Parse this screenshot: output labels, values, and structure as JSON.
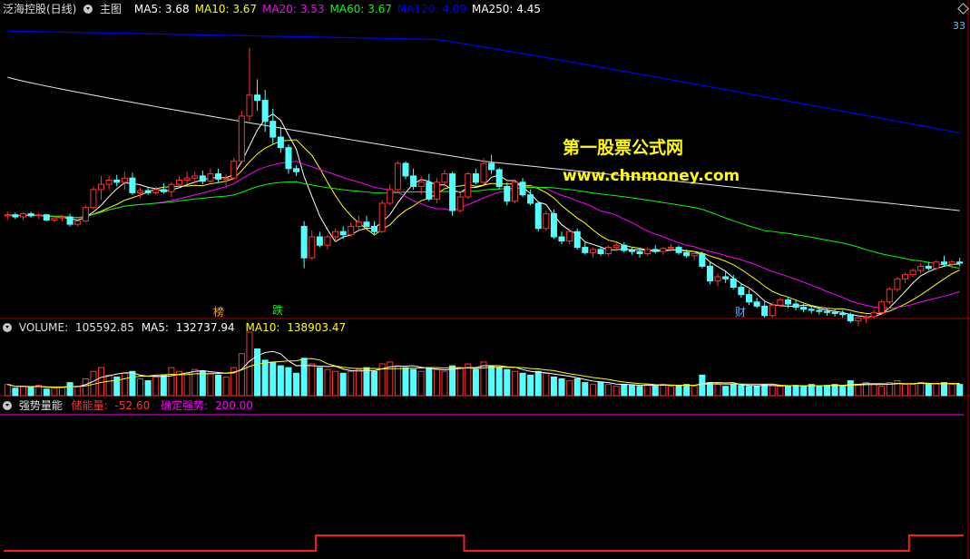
{
  "main": {
    "stock_name": "泛海控股(日线)",
    "panel_label": "主图",
    "ma": [
      {
        "label": "MA5:",
        "value": "3.68",
        "color": "#ffffff"
      },
      {
        "label": "MA10:",
        "value": "3.67",
        "color": "#ffff00"
      },
      {
        "label": "MA20:",
        "value": "3.53",
        "color": "#ff00ff"
      },
      {
        "label": "MA60:",
        "value": "3.67",
        "color": "#00ff00"
      },
      {
        "label": "MA120:",
        "value": "4.09",
        "color": "#0000ff"
      },
      {
        "label": "MA250:",
        "value": "4.45",
        "color": "#ffffff"
      }
    ],
    "corner_value": "33",
    "watermark_line1": "第一股票公式网",
    "watermark_line2": "www.chnmoney.com",
    "markers": [
      {
        "text": "榜",
        "color": "#ffaa00"
      },
      {
        "text": "跌",
        "color": "#00ff00"
      },
      {
        "text": "财",
        "color": "#66aaff"
      }
    ]
  },
  "volume": {
    "label": "VOLUME:",
    "value": "105592.85",
    "ma5_label": "MA5:",
    "ma5_value": "132737.94",
    "ma10_label": "MA10:",
    "ma10_value": "138903.47"
  },
  "indicator": {
    "name": "强势量能",
    "line1_label": "储能量:",
    "line1_value": "-52.60",
    "line2_label": "确定强势:",
    "line2_value": "200.00"
  },
  "colors": {
    "up": "#ff3232",
    "down": "#54ffff",
    "border": "#b00000",
    "ma5": "#ffffff",
    "ma10": "#ffff00",
    "ma20": "#ff00ff",
    "ma60": "#00ff00",
    "ma120": "#0000ff",
    "ma250": "#ffffff"
  },
  "chart_data": {
    "type": "candlestick",
    "ylim": [
      2.4,
      5.2
    ],
    "candles": [
      [
        3.3,
        3.34,
        3.26,
        3.31
      ],
      [
        3.31,
        3.33,
        3.27,
        3.29
      ],
      [
        3.29,
        3.33,
        3.26,
        3.32
      ],
      [
        3.32,
        3.34,
        3.28,
        3.3
      ],
      [
        3.3,
        3.33,
        3.27,
        3.31
      ],
      [
        3.31,
        3.32,
        3.25,
        3.26
      ],
      [
        3.26,
        3.3,
        3.24,
        3.28
      ],
      [
        3.28,
        3.31,
        3.25,
        3.29
      ],
      [
        3.29,
        3.32,
        3.2,
        3.22
      ],
      [
        3.22,
        3.26,
        3.2,
        3.25
      ],
      [
        3.25,
        3.4,
        3.24,
        3.38
      ],
      [
        3.38,
        3.58,
        3.36,
        3.55
      ],
      [
        3.55,
        3.68,
        3.45,
        3.6
      ],
      [
        3.6,
        3.68,
        3.55,
        3.64
      ],
      [
        3.64,
        3.69,
        3.58,
        3.62
      ],
      [
        3.62,
        3.72,
        3.55,
        3.66
      ],
      [
        3.66,
        3.71,
        3.5,
        3.52
      ],
      [
        3.52,
        3.57,
        3.47,
        3.54
      ],
      [
        3.54,
        3.57,
        3.5,
        3.52
      ],
      [
        3.52,
        3.58,
        3.5,
        3.55
      ],
      [
        3.55,
        3.61,
        3.51,
        3.53
      ],
      [
        3.53,
        3.62,
        3.48,
        3.6
      ],
      [
        3.6,
        3.68,
        3.57,
        3.64
      ],
      [
        3.64,
        3.72,
        3.6,
        3.66
      ],
      [
        3.66,
        3.72,
        3.62,
        3.68
      ],
      [
        3.68,
        3.73,
        3.6,
        3.63
      ],
      [
        3.63,
        3.75,
        3.61,
        3.7
      ],
      [
        3.7,
        3.75,
        3.62,
        3.65
      ],
      [
        3.65,
        3.7,
        3.58,
        3.66
      ],
      [
        3.66,
        3.85,
        3.65,
        3.82
      ],
      [
        3.82,
        4.3,
        3.8,
        4.25
      ],
      [
        4.25,
        4.9,
        4.2,
        4.45
      ],
      [
        4.45,
        4.6,
        4.3,
        4.4
      ],
      [
        4.4,
        4.5,
        4.1,
        4.2
      ],
      [
        4.2,
        4.32,
        3.98,
        4.05
      ],
      [
        4.05,
        4.15,
        3.9,
        3.95
      ],
      [
        3.95,
        3.98,
        3.7,
        3.75
      ],
      [
        3.75,
        3.78,
        3.68,
        3.72
      ],
      [
        3.2,
        3.25,
        2.8,
        2.9
      ],
      [
        2.9,
        3.16,
        2.88,
        3.1
      ],
      [
        3.1,
        3.15,
        3.0,
        3.02
      ],
      [
        3.02,
        3.12,
        2.98,
        3.1
      ],
      [
        3.1,
        3.18,
        3.05,
        3.15
      ],
      [
        3.15,
        3.2,
        3.08,
        3.12
      ],
      [
        3.12,
        3.24,
        3.1,
        3.2
      ],
      [
        3.2,
        3.3,
        3.15,
        3.24
      ],
      [
        3.24,
        3.3,
        3.18,
        3.2
      ],
      [
        3.2,
        3.25,
        3.12,
        3.15
      ],
      [
        3.15,
        3.45,
        3.14,
        3.42
      ],
      [
        3.42,
        3.6,
        3.4,
        3.55
      ],
      [
        3.55,
        3.82,
        3.52,
        3.8
      ],
      [
        3.8,
        3.82,
        3.65,
        3.68
      ],
      [
        3.68,
        3.75,
        3.55,
        3.58
      ],
      [
        3.58,
        3.68,
        3.5,
        3.62
      ],
      [
        3.62,
        3.7,
        3.44,
        3.46
      ],
      [
        3.46,
        3.66,
        3.42,
        3.62
      ],
      [
        3.62,
        3.74,
        3.58,
        3.7
      ],
      [
        3.7,
        3.72,
        3.3,
        3.35
      ],
      [
        3.35,
        3.52,
        3.33,
        3.48
      ],
      [
        3.48,
        3.72,
        3.46,
        3.7
      ],
      [
        3.7,
        3.75,
        3.6,
        3.62
      ],
      [
        3.62,
        3.85,
        3.6,
        3.8
      ],
      [
        3.8,
        3.88,
        3.7,
        3.74
      ],
      [
        3.74,
        3.76,
        3.55,
        3.58
      ],
      [
        3.58,
        3.62,
        3.4,
        3.44
      ],
      [
        3.44,
        3.65,
        3.42,
        3.62
      ],
      [
        3.62,
        3.66,
        3.48,
        3.5
      ],
      [
        3.5,
        3.55,
        3.4,
        3.42
      ],
      [
        3.42,
        3.44,
        3.15,
        3.18
      ],
      [
        3.18,
        3.35,
        3.16,
        3.32
      ],
      [
        3.32,
        3.36,
        3.08,
        3.1
      ],
      [
        3.1,
        3.15,
        3.03,
        3.06
      ],
      [
        3.06,
        3.18,
        3.03,
        3.15
      ],
      [
        3.15,
        3.18,
        2.98,
        3.0
      ],
      [
        3.0,
        3.05,
        2.93,
        2.95
      ],
      [
        2.95,
        3.0,
        2.9,
        2.98
      ],
      [
        2.98,
        3.0,
        2.92,
        2.94
      ],
      [
        2.94,
        3.02,
        2.92,
        3.0
      ],
      [
        3.0,
        3.05,
        2.96,
        3.02
      ],
      [
        3.02,
        3.05,
        2.95,
        2.97
      ],
      [
        2.97,
        3.0,
        2.93,
        2.96
      ],
      [
        2.96,
        2.99,
        2.9,
        2.94
      ],
      [
        2.94,
        3.0,
        2.92,
        2.98
      ],
      [
        2.98,
        3.02,
        2.94,
        2.96
      ],
      [
        2.96,
        3.0,
        2.93,
        2.99
      ],
      [
        2.99,
        3.03,
        2.96,
        3.0
      ],
      [
        3.0,
        3.02,
        2.93,
        2.95
      ],
      [
        2.95,
        2.98,
        2.9,
        2.92
      ],
      [
        2.92,
        2.96,
        2.88,
        2.94
      ],
      [
        2.94,
        2.96,
        2.8,
        2.82
      ],
      [
        2.82,
        2.86,
        2.65,
        2.68
      ],
      [
        2.68,
        2.75,
        2.63,
        2.72
      ],
      [
        2.72,
        2.78,
        2.66,
        2.7
      ],
      [
        2.7,
        2.74,
        2.6,
        2.62
      ],
      [
        2.62,
        2.66,
        2.52,
        2.55
      ],
      [
        2.55,
        2.6,
        2.45,
        2.48
      ],
      [
        2.48,
        2.52,
        2.42,
        2.44
      ],
      [
        2.44,
        2.48,
        2.33,
        2.35
      ],
      [
        2.35,
        2.48,
        2.33,
        2.45
      ],
      [
        2.45,
        2.52,
        2.43,
        2.5
      ],
      [
        2.5,
        2.52,
        2.42,
        2.46
      ],
      [
        2.46,
        2.5,
        2.4,
        2.43
      ],
      [
        2.43,
        2.46,
        2.38,
        2.41
      ],
      [
        2.41,
        2.44,
        2.37,
        2.4
      ],
      [
        2.4,
        2.43,
        2.36,
        2.39
      ],
      [
        2.39,
        2.42,
        2.35,
        2.38
      ],
      [
        2.38,
        2.41,
        2.34,
        2.37
      ],
      [
        2.37,
        2.4,
        2.33,
        2.36
      ],
      [
        2.36,
        2.38,
        2.28,
        2.3
      ],
      [
        2.3,
        2.35,
        2.25,
        2.33
      ],
      [
        2.33,
        2.36,
        2.28,
        2.34
      ],
      [
        2.34,
        2.4,
        2.32,
        2.38
      ],
      [
        2.38,
        2.5,
        2.36,
        2.48
      ],
      [
        2.48,
        2.62,
        2.46,
        2.6
      ],
      [
        2.6,
        2.72,
        2.58,
        2.7
      ],
      [
        2.7,
        2.76,
        2.66,
        2.74
      ],
      [
        2.74,
        2.8,
        2.72,
        2.78
      ],
      [
        2.78,
        2.85,
        2.75,
        2.82
      ],
      [
        2.82,
        2.86,
        2.78,
        2.8
      ],
      [
        2.8,
        2.88,
        2.78,
        2.86
      ],
      [
        2.86,
        2.92,
        2.82,
        2.84
      ],
      [
        2.84,
        2.88,
        2.8,
        2.86
      ],
      [
        2.86,
        2.9,
        2.82,
        2.85
      ]
    ],
    "volume": [
      12,
      8,
      10,
      9,
      11,
      7,
      8,
      9,
      14,
      10,
      18,
      26,
      30,
      22,
      20,
      24,
      26,
      18,
      16,
      20,
      22,
      30,
      26,
      24,
      28,
      26,
      24,
      22,
      20,
      30,
      45,
      68,
      50,
      38,
      36,
      32,
      30,
      24,
      40,
      34,
      30,
      28,
      26,
      24,
      26,
      28,
      30,
      26,
      34,
      36,
      32,
      30,
      28,
      26,
      30,
      28,
      26,
      32,
      30,
      34,
      28,
      36,
      32,
      30,
      28,
      26,
      24,
      22,
      26,
      24,
      20,
      18,
      16,
      18,
      14,
      12,
      14,
      12,
      10,
      12,
      11,
      10,
      12,
      11,
      12,
      10,
      11,
      12,
      10,
      22,
      14,
      12,
      10,
      12,
      11,
      10,
      10,
      12,
      11,
      10,
      10,
      11,
      10,
      12,
      10,
      11,
      12,
      10,
      16,
      12,
      14,
      12,
      10,
      14,
      16,
      12,
      12,
      14,
      12,
      13,
      14,
      12,
      12
    ],
    "indicator": {
      "series": [
        {
          "name": "储能量",
          "value": -52.6
        },
        {
          "name": "确定强势",
          "value": 200.0
        }
      ],
      "levels": [
        [
          0,
          40,
          0
        ],
        [
          40,
          59,
          1
        ],
        [
          59,
          116,
          0
        ],
        [
          116,
          248,
          1
        ]
      ]
    }
  }
}
